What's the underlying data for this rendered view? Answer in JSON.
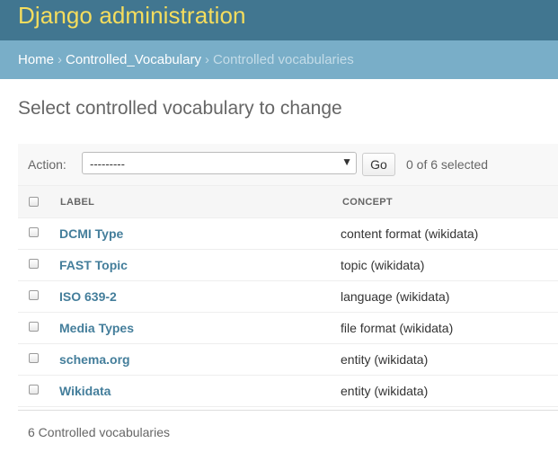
{
  "header": {
    "site_title": "Django administration"
  },
  "breadcrumbs": {
    "home": "Home",
    "app": "Controlled_Vocabulary",
    "current": "Controlled vocabularies",
    "separator": "›"
  },
  "page_title": "Select controlled vocabulary to change",
  "actions": {
    "label": "Action:",
    "selected_value": "---------",
    "go_label": "Go",
    "selection_count": "0 of 6 selected"
  },
  "table": {
    "columns": [
      "LABEL",
      "CONCEPT"
    ],
    "rows": [
      {
        "label": "DCMI Type",
        "concept": "content format (wikidata)"
      },
      {
        "label": "FAST Topic",
        "concept": "topic (wikidata)"
      },
      {
        "label": "ISO 639-2",
        "concept": "language (wikidata)"
      },
      {
        "label": "Media Types",
        "concept": "file format (wikidata)"
      },
      {
        "label": "schema.org",
        "concept": "entity (wikidata)"
      },
      {
        "label": "Wikidata",
        "concept": "entity (wikidata)"
      }
    ]
  },
  "paginator": {
    "text": "6 Controlled vocabularies"
  },
  "colors": {
    "header_bg": "#417690",
    "branding": "#f5dd5d",
    "breadcrumbs_bg": "#79aec8",
    "link": "#447e9b"
  }
}
